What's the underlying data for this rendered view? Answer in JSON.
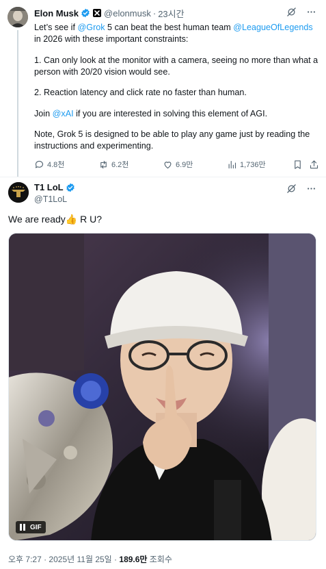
{
  "quoted_post": {
    "author_name": "Elon Musk",
    "author_handle": "@elonmusk",
    "separator": "·",
    "time": "23시간",
    "body": {
      "p1_part1": "Let’s see if ",
      "p1_link1": "@Grok",
      "p1_part2": " 5 can beat the best human team ",
      "p1_link2": "@LeagueOfLegends",
      "p1_part3": " in 2026 with these important constraints:",
      "p2": "1. Can only look at the monitor with a camera, seeing no more than what a person with 20/20 vision would see.",
      "p3": "2. Reaction latency and click rate no faster than human.",
      "p4_part1": "Join ",
      "p4_link": "@xAI",
      "p4_part2": " if you are interested in solving this element of AGI.",
      "p5": "Note, Grok 5 is designed to be able to play any game just by reading the instructions and experimenting."
    },
    "actions": {
      "replies": "4.8천",
      "reposts": "6.2천",
      "likes": "6.9만",
      "views": "1,736만"
    }
  },
  "main_post": {
    "author_name": "T1 LoL",
    "author_handle": "@T1LoL",
    "text_before_emoji": "We are ready",
    "emoji": "👍",
    "text_after_emoji": " R U?",
    "media_badge": "GIF",
    "meta_time": "오후 7:27 · 2025년 11월 25일 · ",
    "meta_views_count": "189.6만",
    "meta_views_label": " 조회수"
  },
  "colors": {
    "link": "#1d9bf0",
    "verified": "#1d9bf0",
    "secondary_text": "#536471",
    "primary_text": "#0f1419",
    "divider": "#eff3f4"
  },
  "icons": [
    "verified-badge-icon",
    "x-affiliate-badge-icon",
    "grok-icon",
    "more-icon",
    "reply-icon",
    "repost-icon",
    "like-icon",
    "views-icon",
    "bookmark-icon",
    "share-icon",
    "gif-pause-icon"
  ]
}
